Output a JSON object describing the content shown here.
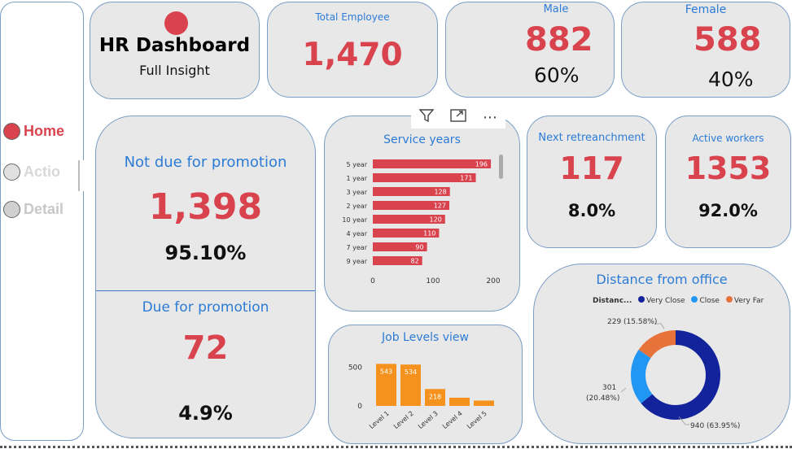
{
  "nav": {
    "items": [
      {
        "label": "Home"
      },
      {
        "label": "Actio"
      },
      {
        "label": "Detail"
      }
    ]
  },
  "title_card": {
    "title": "HR Dashboard",
    "subtitle": "Full Insight"
  },
  "total": {
    "label": "Total Employee",
    "value": "1,470"
  },
  "male": {
    "label": "Male",
    "value": "882",
    "pct": "60%"
  },
  "female": {
    "label": "Female",
    "value": "588",
    "pct": "40%"
  },
  "promotion": {
    "not_due_label": "Not due for promotion",
    "not_due_value": "1,398",
    "not_due_pct": "95.10%",
    "due_label": "Due for promotion",
    "due_value": "72",
    "due_pct": "4.9%"
  },
  "retrench": {
    "label": "Next retreanchment",
    "value": "117",
    "pct": "8.0%"
  },
  "active": {
    "label": "Active workers",
    "value": "1353",
    "pct": "92.0%"
  },
  "colors": {
    "accent_red": "#d9434e",
    "title_blue": "#2c7bd6",
    "bar_orange": "#f5921e"
  },
  "toolbar": {
    "icons": [
      "filter-icon",
      "focus-mode-icon",
      "more-options-icon"
    ]
  },
  "service_chart": {
    "title": "Service years",
    "chart_data": {
      "type": "bar",
      "orientation": "horizontal",
      "categories": [
        "5 year",
        "1 year",
        "3 year",
        "2 year",
        "10 year",
        "4 year",
        "7 year",
        "9 year"
      ],
      "values": [
        196,
        171,
        128,
        127,
        120,
        110,
        90,
        82
      ],
      "xlim": [
        0,
        200
      ],
      "ticks": [
        "0",
        "100",
        "200"
      ]
    }
  },
  "job_chart": {
    "title": "Job Levels view",
    "chart_data": {
      "type": "bar",
      "categories": [
        "Level 1",
        "Level 2",
        "Level 3",
        "Level 4",
        "Level 5"
      ],
      "values": [
        543,
        534,
        218,
        106,
        69
      ],
      "data_labels": [
        "543",
        "534",
        "218",
        "",
        ""
      ],
      "ylim": [
        0,
        620
      ],
      "ticks": [
        "0",
        "500"
      ]
    }
  },
  "distance_chart": {
    "title": "Distance from office",
    "legend_title": "Distanc...",
    "chart_data": {
      "type": "pie",
      "donut": true,
      "labels": [
        "Very Close",
        "Close",
        "Very Far"
      ],
      "values": [
        940,
        301,
        229
      ],
      "colors": [
        "#13239c",
        "#2196f3",
        "#e8733a"
      ],
      "data_labels": [
        "940 (63.95%)",
        "301\n(20.48%)",
        "229 (15.58%)"
      ]
    },
    "label_very_far": "229 (15.58%)",
    "label_close_1": "301",
    "label_close_2": "(20.48%)",
    "label_very_close": "940 (63.95%)"
  }
}
